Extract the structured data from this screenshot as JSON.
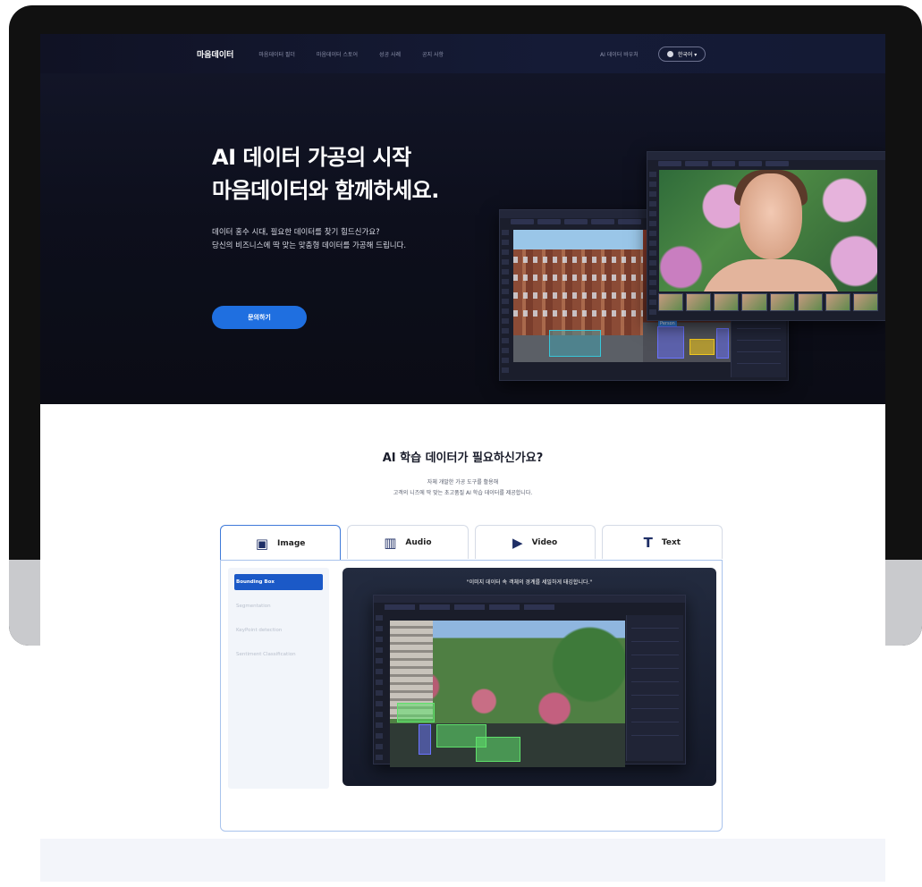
{
  "nav": {
    "brand": "마음데이터",
    "links": [
      "마음데이터 필더",
      "마음데이터 스토어",
      "성공 사례",
      "공지 사항"
    ],
    "right_link": "AI 데이터 바우처",
    "language": "한국어 ▾"
  },
  "hero": {
    "title_line1": "AI 데이터 가공의 시작",
    "title_line2": "마음데이터와 함께하세요.",
    "sub_line1": "데이터 홍수 시대, 필요한 데이터를 찾기 힘드신가요?",
    "sub_line2": "당신의 비즈니스에 딱 맞는 맞춤형 데이터를 가공해 드립니다.",
    "cta": "문의하기"
  },
  "mockup": {
    "tag_label": "Person"
  },
  "section": {
    "title": "AI 학습 데이터가 필요하신가요?",
    "desc_line1": "자체 개발한 가공 도구를 활용해",
    "desc_line2": "고객의 니즈에 딱 맞는 초고품질 AI 학습 데이터를 제공합니다.",
    "tabs": [
      {
        "label": "Image",
        "icon": "image-icon"
      },
      {
        "label": "Audio",
        "icon": "audio-icon"
      },
      {
        "label": "Video",
        "icon": "video-icon"
      },
      {
        "label": "Text",
        "icon": "text-icon"
      }
    ],
    "menu": [
      "Bounding Box",
      "Segmentation",
      "KeyPoint detection",
      "Sentiment Classification"
    ],
    "demo_quote": "\"이미지 데이터 속 객체의 경계를 세밀하게 태깅합니다.\""
  },
  "colors": {
    "accent": "#1f6fe0",
    "active_menu": "#1b59c7",
    "hero_bg": "#0d0f1c"
  }
}
